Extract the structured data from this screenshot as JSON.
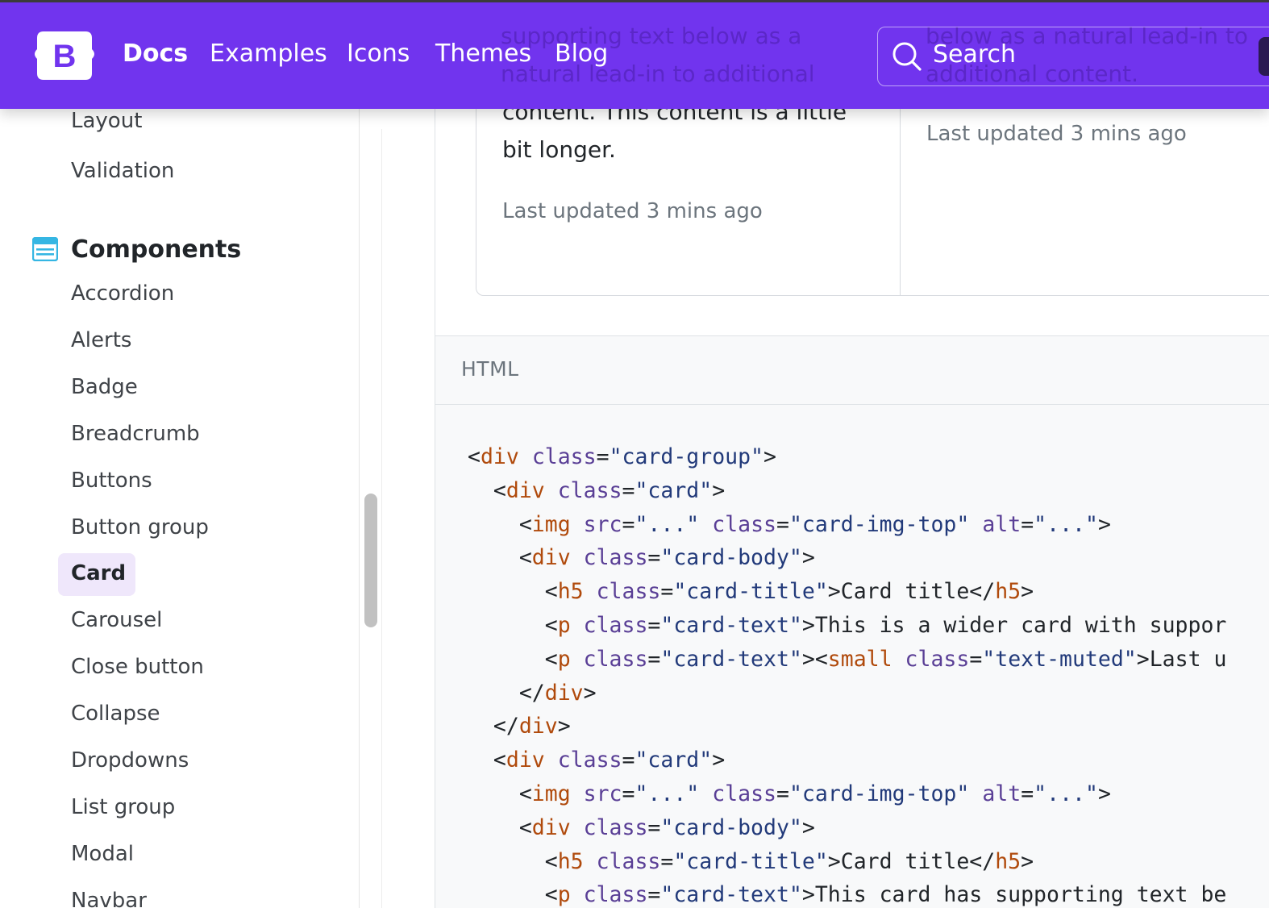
{
  "navbar": {
    "links": [
      {
        "label": "Docs",
        "active": true
      },
      {
        "label": "Examples"
      },
      {
        "label": "Icons"
      },
      {
        "label": "Themes"
      },
      {
        "label": "Blog"
      }
    ],
    "search_label": "Search",
    "brand_color": "#7134ee",
    "ghost_lines": [
      "supporting text below as a",
      "natural lead-in to additional",
      "below as a natural lead-in to",
      "additional content."
    ]
  },
  "sidebar": {
    "partial_item": "Layout",
    "validation": "Validation",
    "section_title": "Components",
    "section_icon": "components-icon",
    "items": [
      "Accordion",
      "Alerts",
      "Badge",
      "Breadcrumb",
      "Buttons",
      "Button group",
      "Card",
      "Carousel",
      "Close button",
      "Collapse",
      "Dropdowns",
      "List group",
      "Modal",
      "Navbar"
    ],
    "active_item": "Card"
  },
  "example": {
    "card1": {
      "text_line3": "content. This content is a little",
      "text_line4": "bit longer.",
      "muted": "Last updated 3 mins ago"
    },
    "card2": {
      "muted": "Last updated 3 mins ago"
    }
  },
  "code": {
    "label": "HTML"
  }
}
